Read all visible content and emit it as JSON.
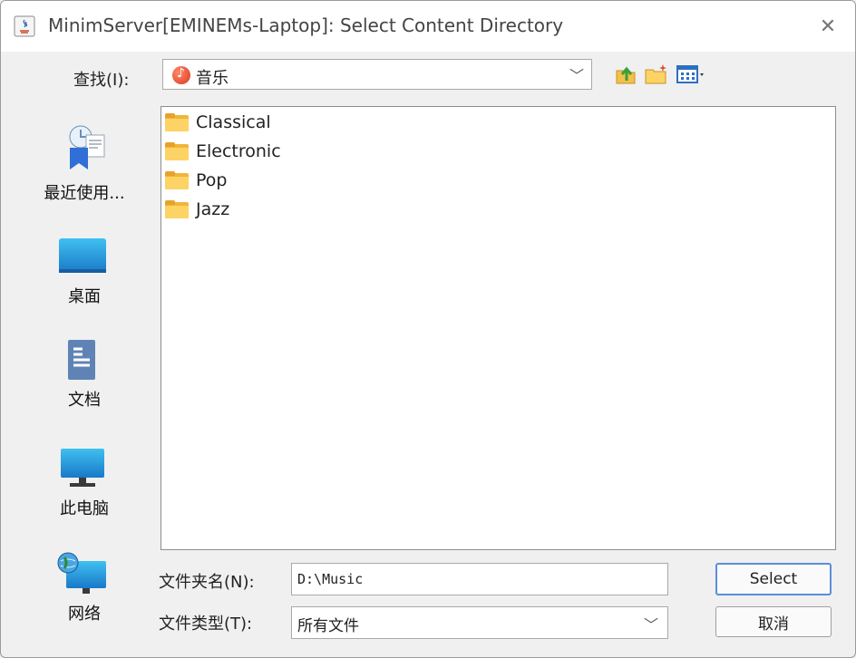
{
  "window": {
    "title": "MinimServer[EMINEMs-Laptop]: Select Content Directory",
    "close_glyph": "✕"
  },
  "lookin": {
    "label": "查找(I):",
    "value": "音乐",
    "icon": "music-icon"
  },
  "toolbar": {
    "icons": [
      "up-folder-icon",
      "new-folder-icon",
      "view-menu-icon"
    ]
  },
  "places": [
    {
      "label": "最近使用...",
      "icon": "recent-icon"
    },
    {
      "label": "桌面",
      "icon": "desktop-icon"
    },
    {
      "label": "文档",
      "icon": "documents-icon"
    },
    {
      "label": "此电脑",
      "icon": "computer-icon"
    },
    {
      "label": "网络",
      "icon": "network-icon"
    }
  ],
  "files": [
    {
      "name": "Classical",
      "icon": "folder-icon"
    },
    {
      "name": "Electronic",
      "icon": "folder-icon"
    },
    {
      "name": "Pop",
      "icon": "folder-icon"
    },
    {
      "name": "Jazz",
      "icon": "folder-icon"
    }
  ],
  "folder_name": {
    "label": "文件夹名(N):",
    "value": "D:\\Music"
  },
  "file_type": {
    "label": "文件类型(T):",
    "value": "所有文件"
  },
  "buttons": {
    "select": "Select",
    "cancel": "取消"
  },
  "colors": {
    "folder": "#f2b43a",
    "primary_border": "#5a8fd8",
    "window_bg": "#f0f0f0"
  }
}
